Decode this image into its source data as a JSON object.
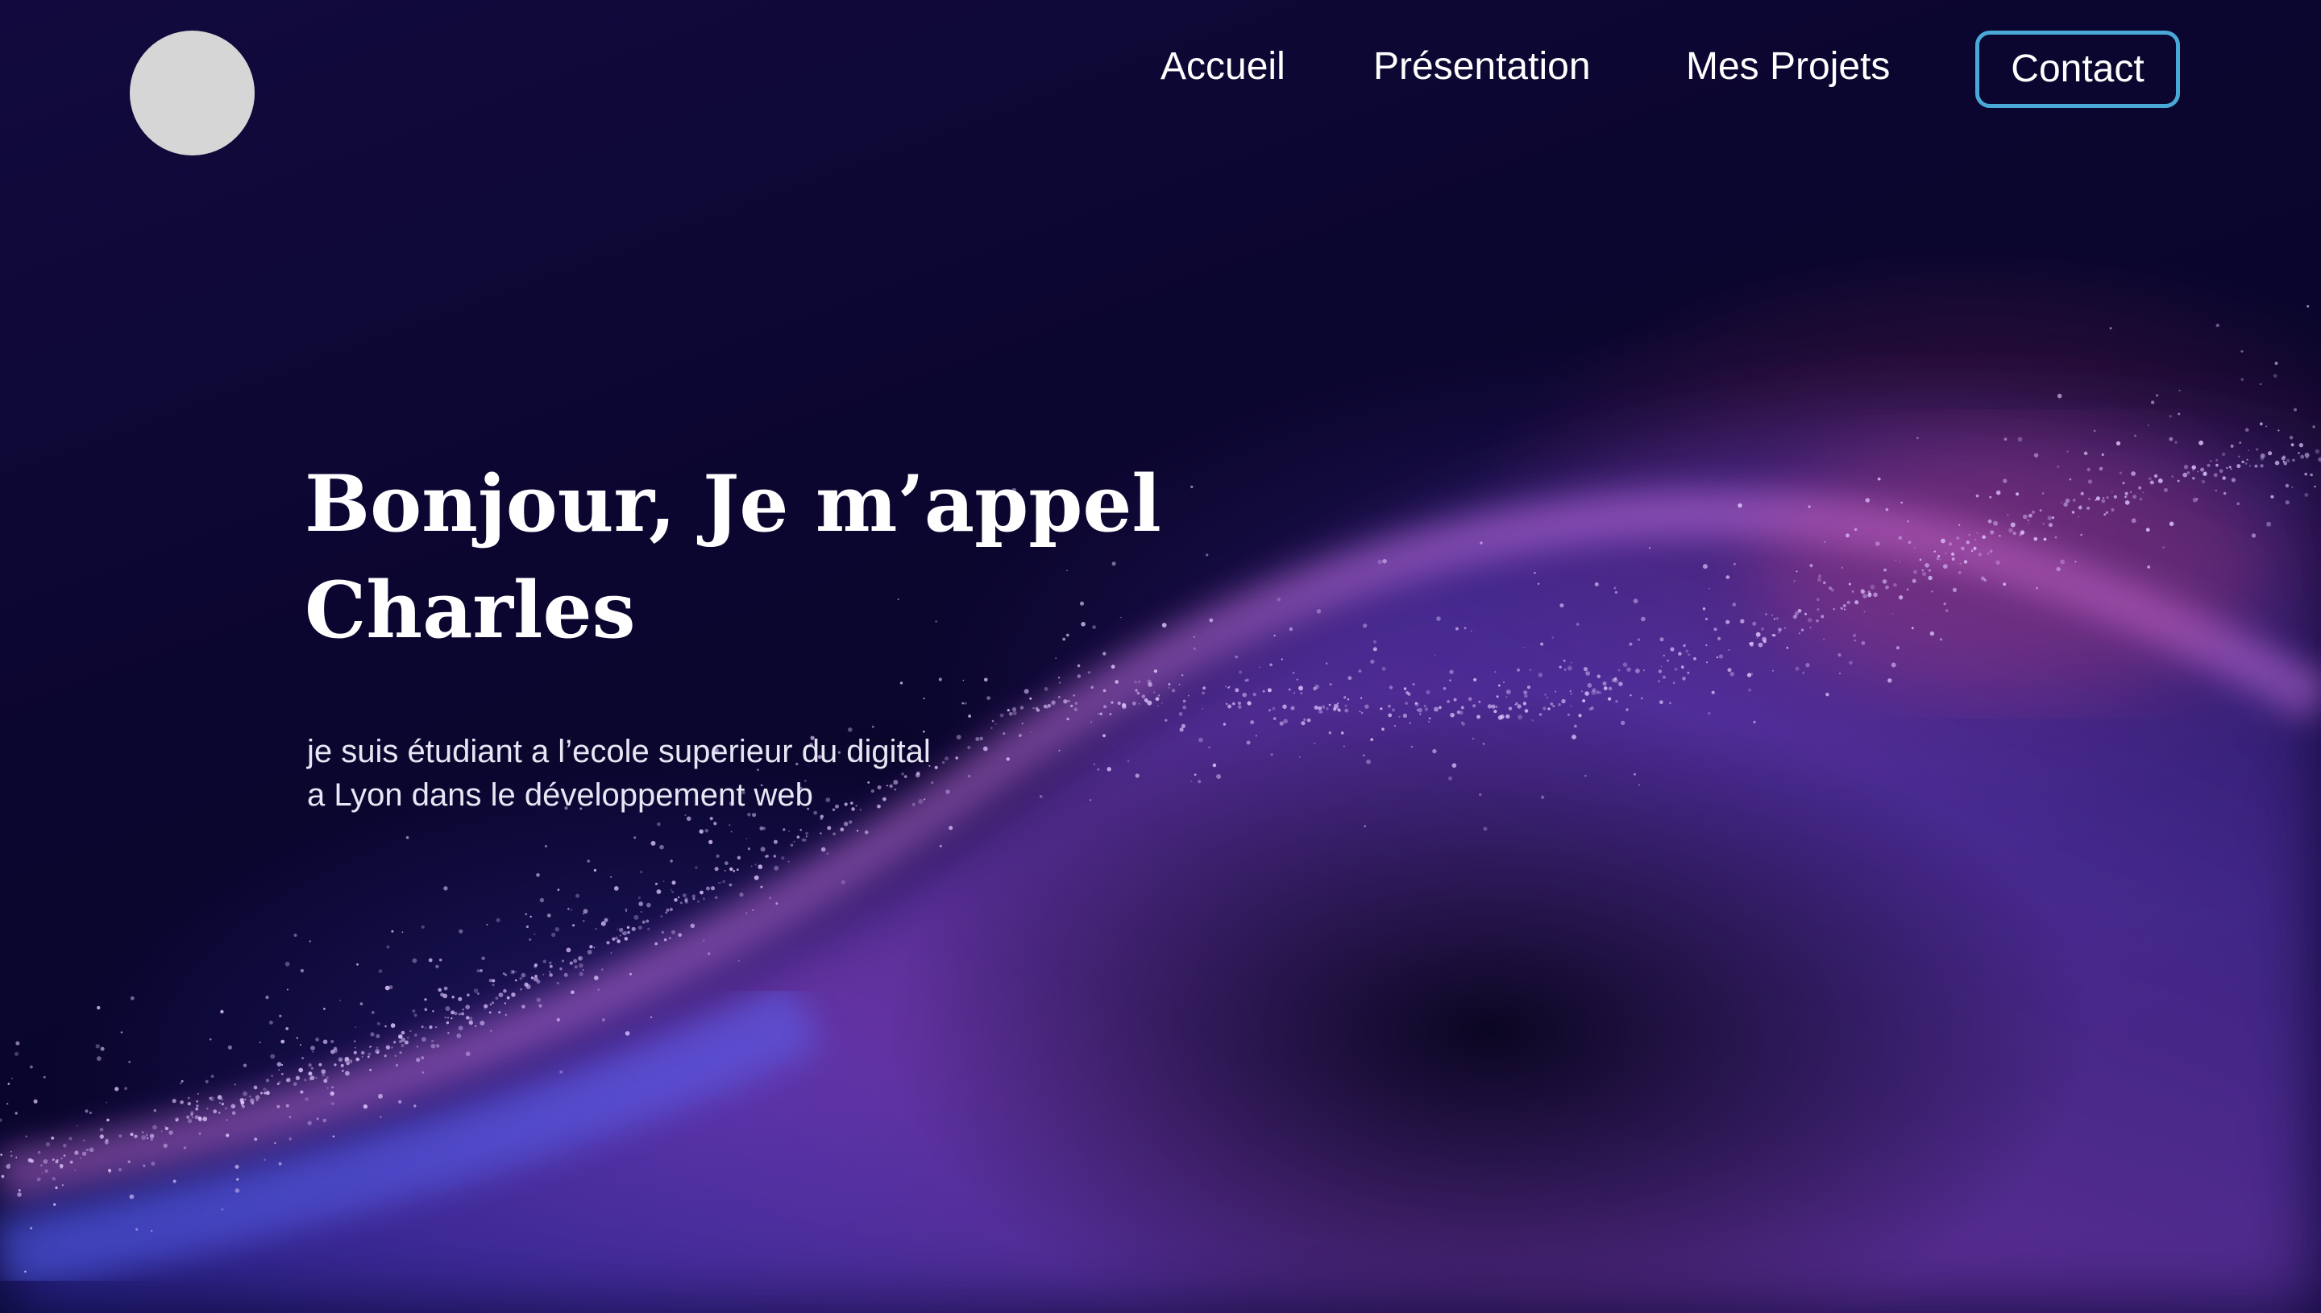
{
  "nav": {
    "items": [
      {
        "label": "Accueil"
      },
      {
        "label": "Présentation"
      },
      {
        "label": "Mes Projets"
      },
      {
        "label": "Contact"
      }
    ]
  },
  "hero": {
    "title_line1": "Bonjour, Je m’appel",
    "title_line2": "Charles",
    "subtitle_line1": "je suis étudiant a l’ecole superieur du digital",
    "subtitle_line2": "a Lyon dans le développement web"
  },
  "colors": {
    "background": "#0a0630",
    "accent_border": "#4aa8d6",
    "logo": "#d6d6d6",
    "text": "#ffffff"
  }
}
